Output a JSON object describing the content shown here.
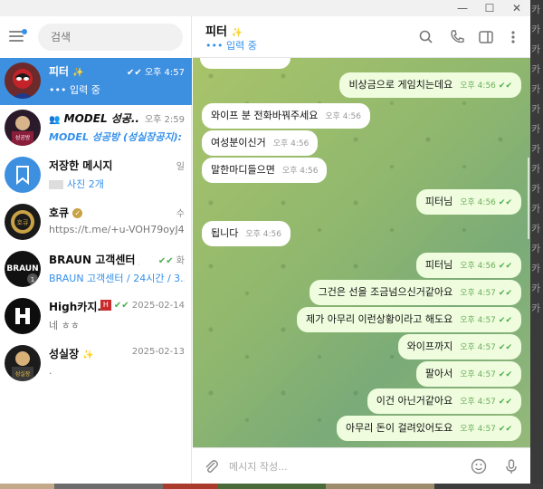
{
  "window": {
    "minimize": "—",
    "maximize": "☐",
    "close": "✕"
  },
  "search": {
    "placeholder": "검색"
  },
  "chats": [
    {
      "title": "피터",
      "emoji": "✨",
      "time": "오후 4:57",
      "preview": "••• 입력 중",
      "active": true,
      "read": true
    },
    {
      "title": "MODEL 성공...",
      "time": "오후 2:59",
      "preview_prefix": "MODEL 성공방 (성실장공지):",
      "preview": ""
    },
    {
      "title": "저장한 메시지",
      "time": "일",
      "preview": "사진 2개"
    },
    {
      "title": "호큐",
      "time": "수",
      "preview": "https://t.me/+u-VOH79oyJ44..."
    },
    {
      "title": "BRAUN 고객센터 / 24...",
      "time": "화",
      "preview": "BRAUN 고객센터 / 24시간 / 3..."
    },
    {
      "title": "High카지...",
      "time": "2025-02-14",
      "preview": "네 ㅎㅎ"
    },
    {
      "title": "성실장",
      "time": "2025-02-13",
      "preview": "."
    }
  ],
  "header": {
    "name": "피터",
    "emoji": "✨",
    "status": "••• 입력 중"
  },
  "messages": [
    {
      "dir": "out",
      "text": "비상금으로 게임치는데요",
      "time": "오후 4:56"
    },
    {
      "dir": "in",
      "text": "와이프 분 전화바꿔주세요",
      "time": "오후 4:56"
    },
    {
      "dir": "in",
      "text": "여성분이신거",
      "time": "오후 4:56"
    },
    {
      "dir": "in",
      "text": "말한마디들으면",
      "time": "오후 4:56"
    },
    {
      "dir": "out",
      "text": "피터님",
      "time": "오후 4:56"
    },
    {
      "dir": "in",
      "text": "됩니다",
      "time": "오후 4:56"
    },
    {
      "dir": "out",
      "text": "피터님",
      "time": "오후 4:56"
    },
    {
      "dir": "out",
      "text": "그건은 선을 조금넘으신거같아요",
      "time": "오후 4:57"
    },
    {
      "dir": "out",
      "text": "제가 아무리 이런상황이라고 해도요",
      "time": "오후 4:57"
    },
    {
      "dir": "out",
      "text": "와이프까지",
      "time": "오후 4:57"
    },
    {
      "dir": "out",
      "text": "팔아서",
      "time": "오후 4:57"
    },
    {
      "dir": "out",
      "text": "이건 아닌거같아요",
      "time": "오후 4:57"
    },
    {
      "dir": "out",
      "text": "아무리 돈이 걸려있어도요",
      "time": "오후 4:57"
    }
  ],
  "composer": {
    "placeholder": "메시지 작성..."
  },
  "colors": {
    "accent": "#3390ec",
    "active_chat": "#3d8fe0",
    "out_bubble": "#effdde",
    "check": "#4fae4e"
  },
  "icons": [
    "menu-icon",
    "search-icon",
    "phone-icon",
    "sidebar-toggle-icon",
    "more-icon",
    "attach-icon",
    "emoji-icon",
    "mic-icon",
    "saved-messages-icon"
  ]
}
